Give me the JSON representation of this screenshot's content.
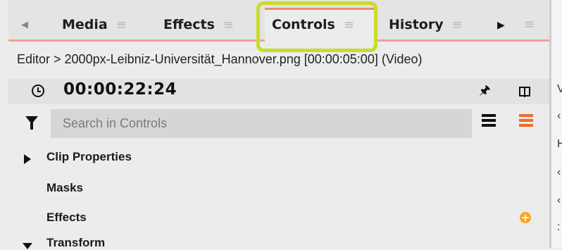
{
  "tabs": [
    {
      "label": "Media"
    },
    {
      "label": "Effects"
    },
    {
      "label": "Controls"
    },
    {
      "label": "History"
    }
  ],
  "tab_menu_glyph": "≡",
  "breadcrumb": "Editor > 2000px-Leibniz-Universität_Hannover.png [00:00:05:00] (Video)",
  "timecode": "00:00:22:24",
  "search": {
    "placeholder": "Search in Controls",
    "value": ""
  },
  "tree": [
    {
      "label": "Clip Properties"
    },
    {
      "label": "Masks"
    },
    {
      "label": "Effects"
    },
    {
      "label": "Transform"
    }
  ],
  "right_edge_glyphs": [
    "V",
    "‹",
    "H",
    "‹",
    "‹",
    ":"
  ],
  "colors": {
    "accent": "#f06a2a",
    "highlight": "#c9dc2a",
    "add": "#f5a623",
    "tab_underline": "#f2a08f"
  }
}
